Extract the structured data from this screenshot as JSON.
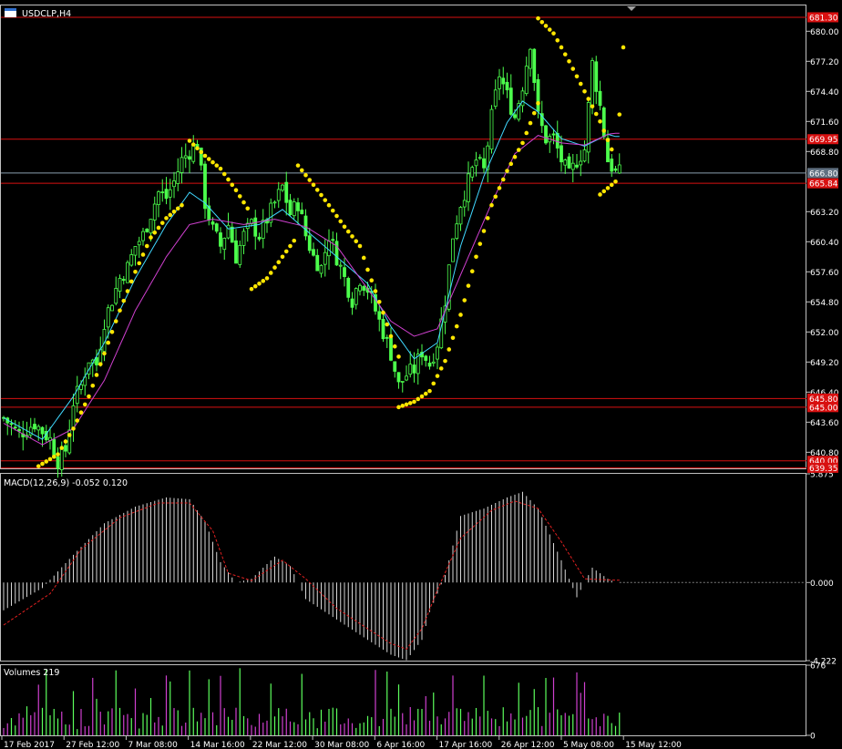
{
  "header": {
    "symbol_title": "USDCLP,H4",
    "macd_title": "MACD(12,26,9) -0.052 0.120",
    "volumes_title": "Volumes 219"
  },
  "colors": {
    "background": "#000000",
    "grid_border": "#c0c0c0",
    "bull_candle": "#4cff4c",
    "bear_candle": "#4cff4c",
    "fast_ma": "#40d8ff",
    "slow_ma": "#d040d0",
    "sar_dots": "#ffe600",
    "hlines": "#d81010",
    "current_price_line": "#8aa0b0",
    "macd_histogram": "#d8d8d8",
    "macd_signal": "#e02020",
    "volume_up": "#5cff5c",
    "volume_down": "#d040d0"
  },
  "chart_data": [
    {
      "type": "candlestick",
      "title": "USDCLP,H4",
      "ylim": [
        639.3,
        682.4
      ],
      "y_ticks": [
        "680.00",
        "677.20",
        "674.40",
        "671.60",
        "668.80",
        "663.20",
        "660.40",
        "657.60",
        "654.80",
        "652.00",
        "649.20",
        "646.40",
        "643.60",
        "640.80"
      ],
      "current_price_label": "666.80",
      "horizontal_levels": [
        {
          "value": 681.3,
          "label": "681.30"
        },
        {
          "value": 669.95,
          "label": "669.95"
        },
        {
          "value": 665.84,
          "label": "665.84"
        },
        {
          "value": 645.8,
          "label": "645.80"
        },
        {
          "value": 645.0,
          "label": "645.00"
        },
        {
          "value": 640.0,
          "label": "640.00"
        },
        {
          "value": 639.35,
          "label": "639.35"
        }
      ],
      "close_path": [
        [
          0,
          644
        ],
        [
          4,
          642.5
        ],
        [
          8,
          643.5
        ],
        [
          12,
          642
        ],
        [
          14,
          640
        ],
        [
          16,
          641
        ],
        [
          18,
          645.5
        ],
        [
          20,
          647
        ],
        [
          22,
          649.5
        ],
        [
          24,
          649
        ],
        [
          26,
          653
        ],
        [
          28,
          655
        ],
        [
          30,
          657
        ],
        [
          32,
          658
        ],
        [
          34,
          660
        ],
        [
          36,
          661
        ],
        [
          38,
          663
        ],
        [
          40,
          665
        ],
        [
          42,
          664.5
        ],
        [
          44,
          666
        ],
        [
          46,
          668
        ],
        [
          48,
          668.8
        ],
        [
          50,
          669.6
        ],
        [
          52,
          664
        ],
        [
          54,
          661.5
        ],
        [
          56,
          660
        ],
        [
          58,
          662
        ],
        [
          60,
          659
        ],
        [
          62,
          661
        ],
        [
          64,
          662
        ],
        [
          66,
          661
        ],
        [
          68,
          662.5
        ],
        [
          70,
          664
        ],
        [
          72,
          665.5
        ],
        [
          74,
          663
        ],
        [
          76,
          664
        ],
        [
          78,
          661
        ],
        [
          80,
          659
        ],
        [
          82,
          658
        ],
        [
          84,
          661
        ],
        [
          86,
          659
        ],
        [
          88,
          657
        ],
        [
          90,
          655
        ],
        [
          92,
          657
        ],
        [
          94,
          656
        ],
        [
          96,
          654
        ],
        [
          98,
          652
        ],
        [
          100,
          650
        ],
        [
          102,
          647
        ],
        [
          104,
          648
        ],
        [
          106,
          648.5
        ],
        [
          108,
          650.2
        ],
        [
          110,
          649
        ],
        [
          112,
          651
        ],
        [
          114,
          655
        ],
        [
          116,
          661
        ],
        [
          118,
          664
        ],
        [
          120,
          666
        ],
        [
          122,
          668
        ],
        [
          124,
          667
        ],
        [
          126,
          672
        ],
        [
          128,
          676
        ],
        [
          130,
          674
        ],
        [
          132,
          672
        ],
        [
          134,
          675
        ],
        [
          136,
          679
        ],
        [
          138,
          672
        ],
        [
          140,
          670
        ],
        [
          142,
          670
        ],
        [
          144,
          668
        ],
        [
          146,
          666.5
        ],
        [
          148,
          668
        ],
        [
          150,
          669
        ],
        [
          152,
          677
        ],
        [
          154,
          673
        ],
        [
          156,
          668
        ],
        [
          158,
          666.8
        ]
      ],
      "series": [
        {
          "name": "fast",
          "values": [
            [
              0,
              644
            ],
            [
              10,
              642
            ],
            [
              18,
              646
            ],
            [
              26,
              651
            ],
            [
              34,
              657
            ],
            [
              42,
              662
            ],
            [
              48,
              665
            ],
            [
              52,
              664
            ],
            [
              58,
              661.6
            ],
            [
              66,
              662
            ],
            [
              72,
              663.4
            ],
            [
              78,
              661.5
            ],
            [
              86,
              659
            ],
            [
              94,
              656.5
            ],
            [
              100,
              652.5
            ],
            [
              106,
              649.5
            ],
            [
              112,
              651
            ],
            [
              118,
              660
            ],
            [
              124,
              666.5
            ],
            [
              130,
              671.5
            ],
            [
              134,
              673.5
            ],
            [
              138,
              672.5
            ],
            [
              144,
              670
            ],
            [
              150,
              669.3
            ],
            [
              156,
              670.4
            ],
            [
              158,
              670.2
            ]
          ]
        },
        {
          "name": "slow",
          "values": [
            [
              0,
              643.5
            ],
            [
              10,
              641.5
            ],
            [
              18,
              643
            ],
            [
              26,
              647.5
            ],
            [
              34,
              654
            ],
            [
              42,
              659
            ],
            [
              48,
              662
            ],
            [
              54,
              662.5
            ],
            [
              62,
              662
            ],
            [
              70,
              662.5
            ],
            [
              78,
              661.8
            ],
            [
              86,
              660
            ],
            [
              94,
              656
            ],
            [
              100,
              653
            ],
            [
              106,
              651.6
            ],
            [
              112,
              652.3
            ],
            [
              120,
              659
            ],
            [
              126,
              664
            ],
            [
              132,
              668.6
            ],
            [
              138,
              670.3
            ],
            [
              144,
              669.6
            ],
            [
              150,
              669.4
            ],
            [
              156,
              670.4
            ],
            [
              158,
              670.5
            ]
          ]
        },
        {
          "name": "sar",
          "segments": [
            [
              [
                9,
                639.5
              ],
              [
                14,
                640.6
              ],
              [
                18,
                643
              ],
              [
                22,
                646
              ],
              [
                26,
                650
              ],
              [
                30,
                654
              ],
              [
                34,
                657.6
              ],
              [
                38,
                660.8
              ],
              [
                42,
                662.6
              ],
              [
                46,
                663.8
              ]
            ],
            [
              [
                48,
                669.8
              ],
              [
                52,
                668.4
              ],
              [
                56,
                667.2
              ],
              [
                60,
                665.2
              ],
              [
                63,
                663.5
              ]
            ],
            [
              [
                64,
                656
              ],
              [
                68,
                657
              ],
              [
                72,
                659
              ],
              [
                75,
                660.5
              ]
            ],
            [
              [
                76,
                667.5
              ],
              [
                80,
                665.7
              ],
              [
                84,
                663.8
              ],
              [
                88,
                661.8
              ],
              [
                92,
                660
              ],
              [
                94,
                657.8
              ],
              [
                96,
                655.8
              ],
              [
                98,
                653.8
              ],
              [
                100,
                651.6
              ],
              [
                102,
                649.7
              ]
            ],
            [
              [
                102,
                645
              ],
              [
                106,
                645.5
              ],
              [
                110,
                646.5
              ],
              [
                114,
                649.3
              ],
              [
                118,
                653.6
              ],
              [
                122,
                659
              ],
              [
                126,
                663.8
              ],
              [
                130,
                667
              ],
              [
                134,
                669.6
              ],
              [
                138,
                673.3
              ]
            ],
            [
              [
                138,
                681.2
              ],
              [
                142,
                679.8
              ],
              [
                146,
                677.2
              ],
              [
                150,
                674.4
              ],
              [
                154,
                671.6
              ],
              [
                157,
                669
              ]
            ],
            [
              [
                154,
                664.8
              ],
              [
                158,
                666
              ],
              [
                160,
                678.5
              ]
            ]
          ]
        }
      ]
    },
    {
      "type": "bar",
      "title": "MACD(12,26,9) -0.052 0.120",
      "ylim": [
        -4.222,
        5.875
      ],
      "y_ticks": [
        "5.875",
        "0.000",
        "-4.222"
      ],
      "histogram_path": [
        [
          0,
          -1.5
        ],
        [
          10,
          -0.3
        ],
        [
          18,
          1.5
        ],
        [
          26,
          3.2
        ],
        [
          34,
          4.1
        ],
        [
          42,
          4.6
        ],
        [
          48,
          4.5
        ],
        [
          52,
          3.3
        ],
        [
          56,
          1.1
        ],
        [
          60,
          0.0
        ],
        [
          64,
          0.2
        ],
        [
          70,
          1.4
        ],
        [
          74,
          0.9
        ],
        [
          78,
          -0.9
        ],
        [
          86,
          -2.0
        ],
        [
          94,
          -3.1
        ],
        [
          100,
          -3.9
        ],
        [
          104,
          -4.2
        ],
        [
          108,
          -3.1
        ],
        [
          110,
          -1.6
        ],
        [
          114,
          0.4
        ],
        [
          118,
          3.6
        ],
        [
          124,
          4.0
        ],
        [
          130,
          4.6
        ],
        [
          134,
          4.9
        ],
        [
          138,
          4.0
        ],
        [
          144,
          1.2
        ],
        [
          148,
          -0.8
        ],
        [
          152,
          0.8
        ],
        [
          156,
          0.2
        ],
        [
          158,
          0.0
        ]
      ],
      "signal_path": [
        [
          0,
          -2.3
        ],
        [
          12,
          -0.6
        ],
        [
          20,
          1.8
        ],
        [
          30,
          3.5
        ],
        [
          40,
          4.3
        ],
        [
          48,
          4.3
        ],
        [
          54,
          2.8
        ],
        [
          58,
          0.5
        ],
        [
          64,
          0.1
        ],
        [
          72,
          1.2
        ],
        [
          78,
          0.2
        ],
        [
          86,
          -1.4
        ],
        [
          94,
          -2.5
        ],
        [
          100,
          -3.3
        ],
        [
          104,
          -3.6
        ],
        [
          108,
          -2.5
        ],
        [
          112,
          -0.4
        ],
        [
          118,
          2.4
        ],
        [
          126,
          3.9
        ],
        [
          132,
          4.4
        ],
        [
          138,
          4.0
        ],
        [
          144,
          2.2
        ],
        [
          150,
          0.2
        ],
        [
          158,
          0.12
        ]
      ]
    },
    {
      "type": "bar",
      "title": "Volumes 219",
      "ylim": [
        0,
        676
      ],
      "y_ticks": [
        "676",
        "0"
      ],
      "last_value": 219
    }
  ],
  "x_axis": {
    "labels": [
      "17 Feb 2017",
      "27 Feb 12:00",
      "7 Mar 08:00",
      "14 Mar 16:00",
      "22 Mar 12:00",
      "30 Mar 08:00",
      "6 Apr 16:00",
      "17 Apr 16:00",
      "26 Apr 12:00",
      "5 May 08:00",
      "15 May 12:00"
    ],
    "label_bar_index": [
      0,
      18,
      36,
      54,
      72,
      90,
      108,
      126,
      144,
      162,
      180
    ]
  }
}
